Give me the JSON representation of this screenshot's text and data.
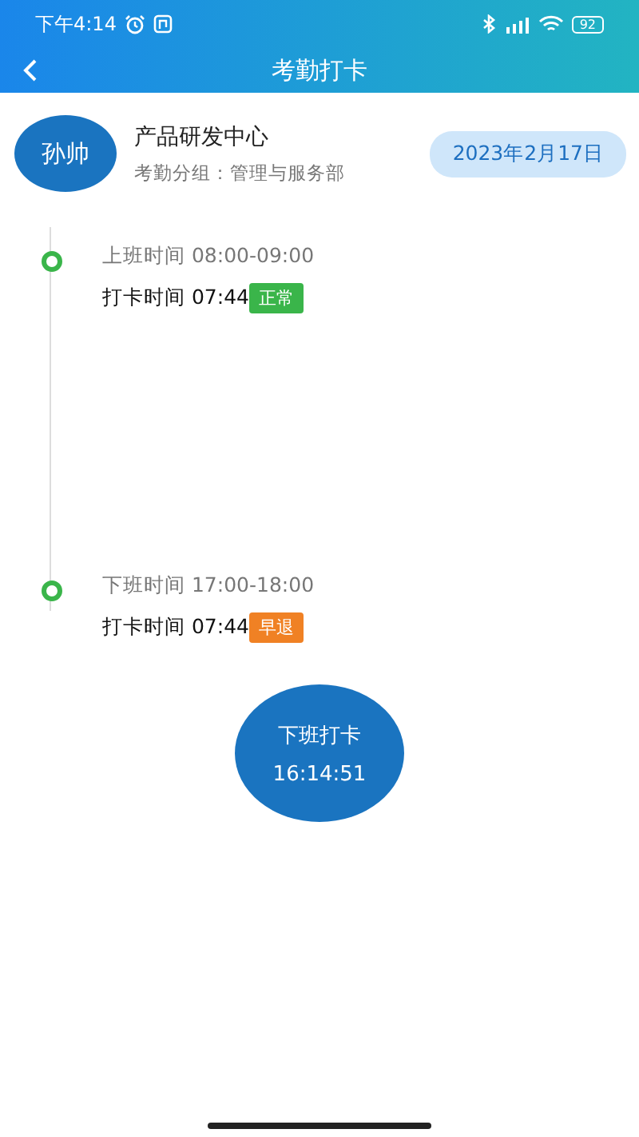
{
  "status_bar": {
    "time": "下午4:14",
    "battery": "92"
  },
  "header": {
    "title": "考勤打卡"
  },
  "profile": {
    "avatar": "孙帅",
    "department": "产品研发中心",
    "group": "考勤分组：管理与服务部",
    "date": "2023年2月17日"
  },
  "records": [
    {
      "schedule": "上班时间 08:00-09:00",
      "punch": "打卡时间 07:44",
      "tag": "正常",
      "color": "#3ab54a"
    },
    {
      "schedule": "下班时间 17:00-18:00",
      "punch": "打卡时间 07:44",
      "tag": "早退",
      "color": "#f08124"
    }
  ],
  "punch_button": {
    "label": "下班打卡",
    "time": "16:14:51"
  }
}
